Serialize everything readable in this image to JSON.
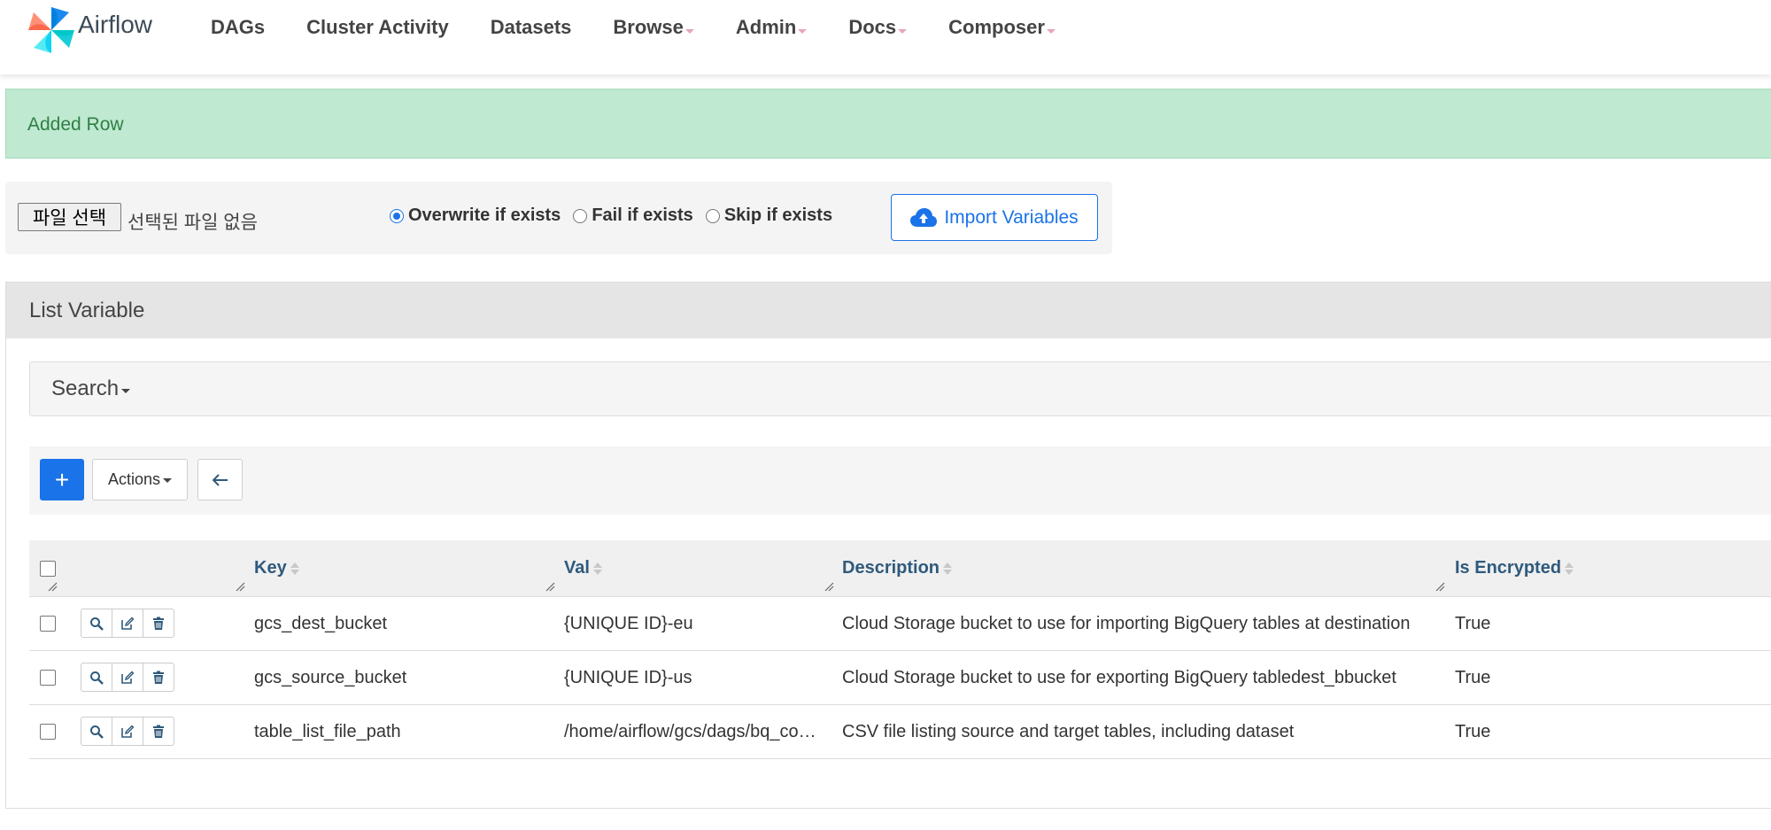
{
  "navbar": {
    "brand": "Airflow",
    "items": [
      {
        "label": "DAGs",
        "dropdown": false
      },
      {
        "label": "Cluster Activity",
        "dropdown": false
      },
      {
        "label": "Datasets",
        "dropdown": false
      },
      {
        "label": "Browse",
        "dropdown": true
      },
      {
        "label": "Admin",
        "dropdown": true
      },
      {
        "label": "Docs",
        "dropdown": true
      },
      {
        "label": "Composer",
        "dropdown": true
      }
    ]
  },
  "flash": {
    "message": "Added Row"
  },
  "import": {
    "file_button": "파일 선택",
    "file_status": "선택된 파일 없음",
    "options": [
      {
        "label": "Overwrite if exists",
        "checked": true
      },
      {
        "label": "Fail if exists",
        "checked": false
      },
      {
        "label": "Skip if exists",
        "checked": false
      }
    ],
    "import_button": "Import Variables"
  },
  "list": {
    "title": "List Variable",
    "search_label": "Search",
    "actions_label": "Actions",
    "add_symbol": "+",
    "columns": [
      "Key",
      "Val",
      "Description",
      "Is Encrypted"
    ],
    "rows": [
      {
        "key": "gcs_dest_bucket",
        "val": "{UNIQUE ID}-eu",
        "description": "Cloud Storage bucket to use for importing BigQuery tables at destination",
        "is_encrypted": "True"
      },
      {
        "key": "gcs_source_bucket",
        "val": "{UNIQUE ID}-us",
        "description": "Cloud Storage bucket to use for exporting BigQuery tabledest_bbucket",
        "is_encrypted": "True"
      },
      {
        "key": "table_list_file_path",
        "val": "/home/airflow/gcs/dags/bq_copy_eu_to_us_sample.csv",
        "description": "CSV file listing source and target tables, including dataset",
        "is_encrypted": "True"
      }
    ]
  },
  "colors": {
    "primary": "#1a73e8",
    "flash_bg": "#bfe9d0",
    "flash_text": "#2f7f45",
    "header_link": "#2f5a7c"
  }
}
